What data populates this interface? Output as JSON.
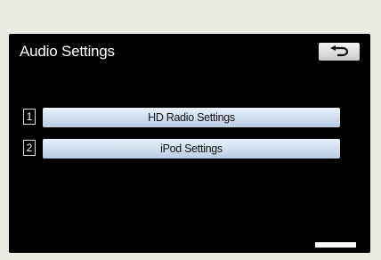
{
  "screen": {
    "title": "Audio Settings",
    "back_icon": "return-arrow-icon"
  },
  "items": [
    {
      "number": "1",
      "label": "HD Radio Settings"
    },
    {
      "number": "2",
      "label": "iPod Settings"
    }
  ]
}
